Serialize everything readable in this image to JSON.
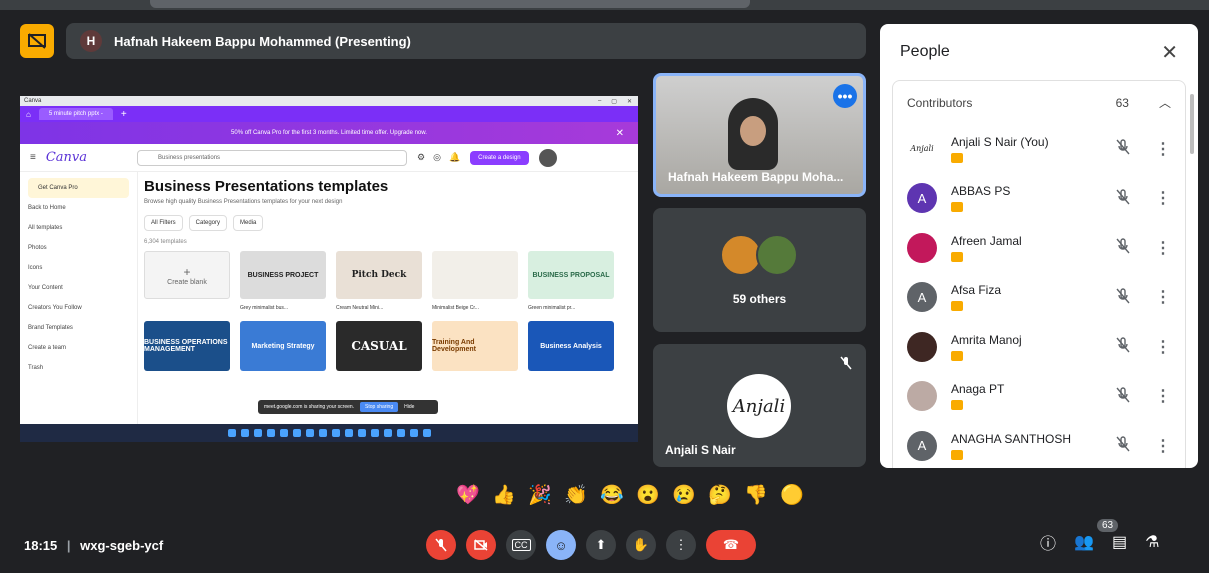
{
  "presenter": {
    "initial": "H",
    "title": "Hafnah Hakeem Bappu Mohammed (Presenting)"
  },
  "shared_screen": {
    "browser_tab": "5 minute pitch pptx -",
    "promo": "50% off Canva Pro for the first 3 months. Limited time offer. Upgrade now.",
    "logo": "Canva",
    "search": "Business presentations",
    "create_btn": "Create a design",
    "sidebar": [
      "Get Canva Pro",
      "Back to Home",
      "All templates",
      "Photos",
      "Icons",
      "Your Content",
      "Creators You Follow",
      "Brand Templates",
      "Create a team",
      "Trash"
    ],
    "heading": "Business Presentations templates",
    "subheading": "Browse high quality Business Presentations templates for your next design",
    "filters": [
      "All Filters",
      "Category",
      "Media"
    ],
    "count": "6,304 templates",
    "cards_row1": [
      "Create blank",
      "BUSINESS PROJECT",
      "Pitch Deck",
      "",
      "BUSINESS PROPOSAL"
    ],
    "labels_row1": [
      "",
      "Grey minimalist bus...",
      "Cream Neutral Mini...",
      "Minimalist Beige Cr...",
      "Green minimalist pr..."
    ],
    "cards_row2": [
      "BUSINESS OPERATIONS MANAGEMENT",
      "Marketing Strategy",
      "CASUAL",
      "Training And Development",
      "Business Analysis"
    ],
    "share_text": "meet.google.com is sharing your screen.",
    "stop_sharing": "Stop sharing",
    "hide": "Hide"
  },
  "tiles": {
    "self_name": "Hafnah Hakeem Bappu Moha...",
    "others_label": "59 others",
    "anjali_name": "Anjali S Nair",
    "anjali_avatar": "Anjali"
  },
  "people_panel": {
    "title": "People",
    "section": "Contributors",
    "count": "63",
    "people": [
      {
        "name": "Anjali S Nair (You)",
        "avatar": "Anjali",
        "color": "#ffffff"
      },
      {
        "name": "ABBAS PS",
        "avatar": "A",
        "color": "#5e35b1"
      },
      {
        "name": "Afreen Jamal",
        "avatar": "",
        "color": "#c2185b"
      },
      {
        "name": "Afsa Fiza",
        "avatar": "A",
        "color": "#5f6368"
      },
      {
        "name": "Amrita Manoj",
        "avatar": "",
        "color": "#3e2723"
      },
      {
        "name": "Anaga PT",
        "avatar": "",
        "color": "#bcaaa4"
      },
      {
        "name": "ANAGHA SANTHOSH",
        "avatar": "A",
        "color": "#5f6368"
      }
    ]
  },
  "reactions": [
    "💖",
    "👍",
    "🎉",
    "👏",
    "😂",
    "😮",
    "😢",
    "🤔",
    "👎",
    "🟡"
  ],
  "meeting": {
    "time": "18:15",
    "code": "wxg-sgeb-ycf",
    "participants_badge": "63"
  }
}
